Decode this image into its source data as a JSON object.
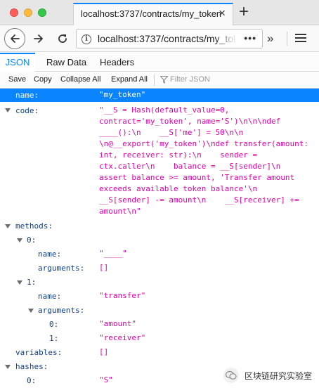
{
  "window": {
    "tab_title": "localhost:3737/contracts/my_token",
    "tab_close": "×",
    "new_tab": "+"
  },
  "toolbar": {
    "url": "localhost:3737/contracts/my_token",
    "page_actions": "•••",
    "overflow": "»",
    "info_icon": "i"
  },
  "viewer": {
    "tabs": [
      {
        "label": "JSON",
        "active": true
      },
      {
        "label": "Raw Data",
        "active": false
      },
      {
        "label": "Headers",
        "active": false
      }
    ],
    "actions": {
      "save": "Save",
      "copy": "Copy",
      "collapse_all": "Collapse All",
      "expand_all": "Expand All",
      "filter_placeholder": "Filter JSON"
    }
  },
  "tree": {
    "name_key": "name:",
    "name_value": "\"my_token\"",
    "code_key": "code:",
    "code_value": "\"__S = Hash(default_value=0,\ncontract='my_token', name='S')\\n\\n\\ndef\n____():\\n    __S['me'] = 50\\n\\n\n\\n@__export('my_token')\\ndef transfer(amount:\nint, receiver: str):\\n    sender =\nctx.caller\\n    balance = __S[sender]\\n\nassert balance >= amount, 'Transfer amount\nexceeds available token balance'\\n\n__S[sender] -= amount\\n    __S[receiver] +=\namount\\n\"",
    "methods_key": "methods:",
    "methods": [
      {
        "index_key": "0:",
        "name_key": "name:",
        "name_value": "\"____\"",
        "arguments_key": "arguments:",
        "arguments_value": "[]"
      },
      {
        "index_key": "1:",
        "name_key": "name:",
        "name_value": "\"transfer\"",
        "arguments_key": "arguments:",
        "arguments": [
          {
            "key": "0:",
            "value": "\"amount\""
          },
          {
            "key": "1:",
            "value": "\"receiver\""
          }
        ]
      }
    ],
    "variables_key": "variables:",
    "variables_value": "[]",
    "hashes_key": "hashes:",
    "hashes": [
      {
        "key": "0:",
        "value": "\"S\""
      }
    ]
  },
  "watermark": {
    "text": "区块链研究实验室"
  },
  "colors": {
    "accent": "#0a84ff",
    "key": "#0b3f8c",
    "string": "#dd00a9"
  }
}
